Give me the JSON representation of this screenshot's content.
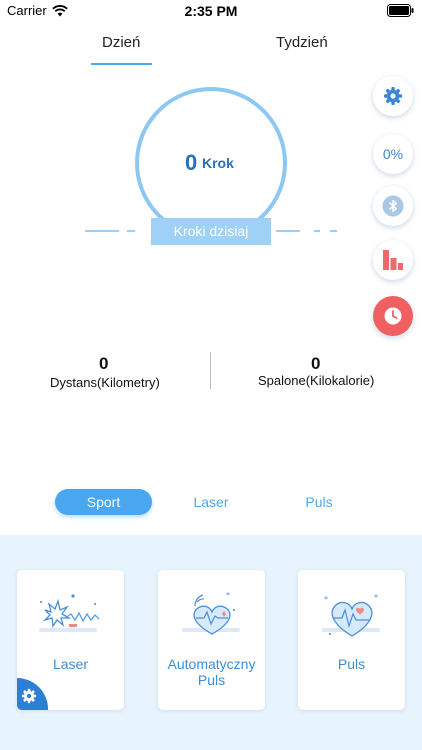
{
  "status_bar": {
    "carrier": "Carrier",
    "time": "2:35 PM"
  },
  "tabs": {
    "day": "Dzień",
    "week": "Tydzień"
  },
  "steps": {
    "count": "0",
    "unit": "Krok",
    "today_label": "Kroki dzisiaj"
  },
  "side_buttons": {
    "settings_icon": "gear-icon",
    "percent": "0%",
    "bluetooth_icon": "bluetooth-icon",
    "chart_icon": "bar-chart-icon",
    "alarm_icon": "clock-icon"
  },
  "stats": {
    "distance": {
      "value": "0",
      "label": "Dystans(Kilometry)"
    },
    "calories": {
      "value": "0",
      "label": "Spalone(Kilokalorie)"
    }
  },
  "segments": [
    "Sport",
    "Laser",
    "Puls"
  ],
  "cards": [
    {
      "label": "Laser"
    },
    {
      "label_line1": "Automatyczny",
      "label_line2": "Puls"
    },
    {
      "label": "Puls"
    }
  ],
  "colors": {
    "accent": "#49a7f0",
    "ring": "#8cc8f2",
    "alarm": "#f16060",
    "chart": "#ee6a6a",
    "panel": "#e7f4fd"
  }
}
